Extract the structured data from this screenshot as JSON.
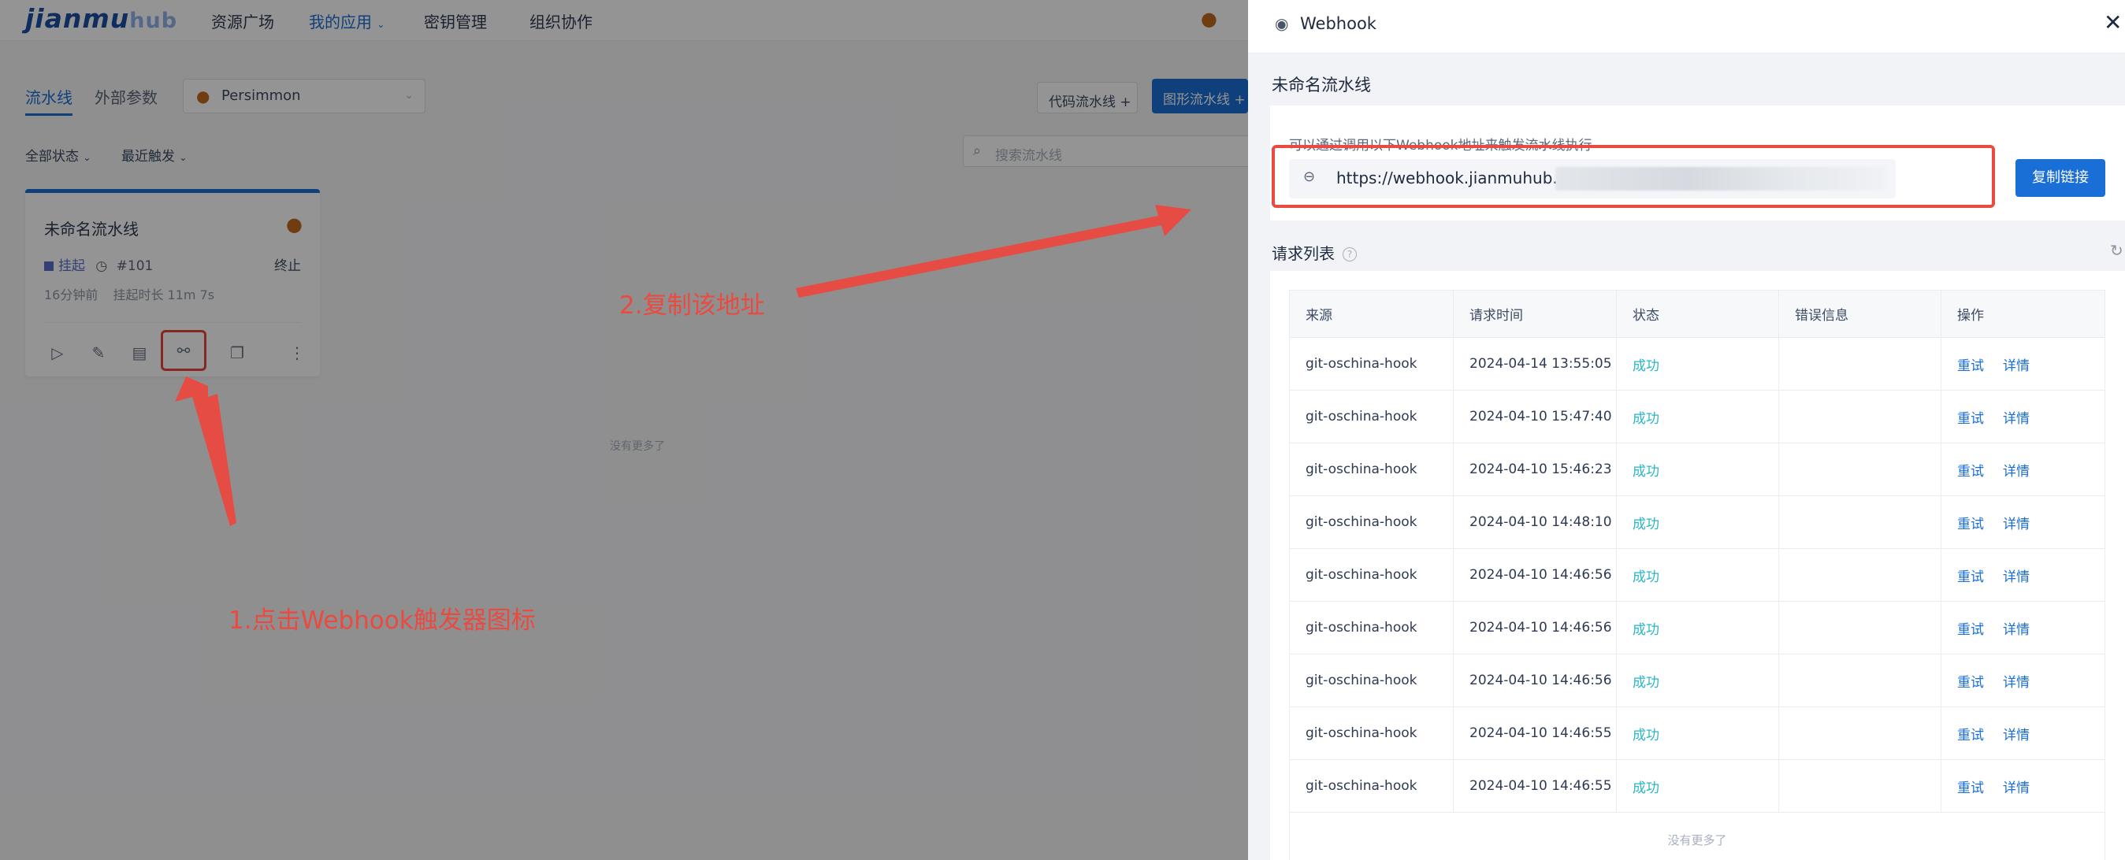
{
  "app": {
    "logo_primary": "jianmu",
    "logo_secondary": "hub",
    "nav": [
      "资源广场",
      "我的应用",
      "密钥管理",
      "组织协作"
    ],
    "tabs": [
      "流水线",
      "外部参数"
    ],
    "project": "Persimmon",
    "code_pipeline_btn": "代码流水线 +",
    "graph_pipeline_btn": "图形流水线 +",
    "filter_status": "全部状态",
    "filter_sort": "最近触发",
    "search_placeholder": "搜索流水线",
    "card": {
      "title": "未命名流水线",
      "status": "挂起",
      "run_number": "#101",
      "stop": "终止",
      "meta_time": "16分钟前",
      "meta_duration": "挂起时长 11m 7s"
    },
    "no_more": "没有更多了"
  },
  "annotations": {
    "step1": "1.点击Webhook触发器图标",
    "step2": "2.复制该地址"
  },
  "drawer": {
    "title": "Webhook",
    "pipeline_name": "未命名流水线",
    "url_hint": "可以通过调用以下Webhook地址来触发流水线执行",
    "url": "https://webhook.jianmuhub.con",
    "copy_button": "复制链接",
    "request_list_title": "请求列表",
    "help_icon": "?",
    "columns": [
      "来源",
      "请求时间",
      "状态",
      "错误信息",
      "操作"
    ],
    "rows": [
      {
        "source": "git-oschina-hook",
        "time": "2024-04-14 13:55:05",
        "status": "成功",
        "error": "",
        "retry": "重试",
        "detail": "详情"
      },
      {
        "source": "git-oschina-hook",
        "time": "2024-04-10 15:47:40",
        "status": "成功",
        "error": "",
        "retry": "重试",
        "detail": "详情"
      },
      {
        "source": "git-oschina-hook",
        "time": "2024-04-10 15:46:23",
        "status": "成功",
        "error": "",
        "retry": "重试",
        "detail": "详情"
      },
      {
        "source": "git-oschina-hook",
        "time": "2024-04-10 14:48:10",
        "status": "成功",
        "error": "",
        "retry": "重试",
        "detail": "详情"
      },
      {
        "source": "git-oschina-hook",
        "time": "2024-04-10 14:46:56",
        "status": "成功",
        "error": "",
        "retry": "重试",
        "detail": "详情"
      },
      {
        "source": "git-oschina-hook",
        "time": "2024-04-10 14:46:56",
        "status": "成功",
        "error": "",
        "retry": "重试",
        "detail": "详情"
      },
      {
        "source": "git-oschina-hook",
        "time": "2024-04-10 14:46:56",
        "status": "成功",
        "error": "",
        "retry": "重试",
        "detail": "详情"
      },
      {
        "source": "git-oschina-hook",
        "time": "2024-04-10 14:46:55",
        "status": "成功",
        "error": "",
        "retry": "重试",
        "detail": "详情"
      },
      {
        "source": "git-oschina-hook",
        "time": "2024-04-10 14:46:55",
        "status": "成功",
        "error": "",
        "retry": "重试",
        "detail": "详情"
      }
    ],
    "no_more": "没有更多了"
  },
  "colors": {
    "accent": "#1a6fd6",
    "annotation": "#ea4a40",
    "success": "#2ab6c8"
  }
}
